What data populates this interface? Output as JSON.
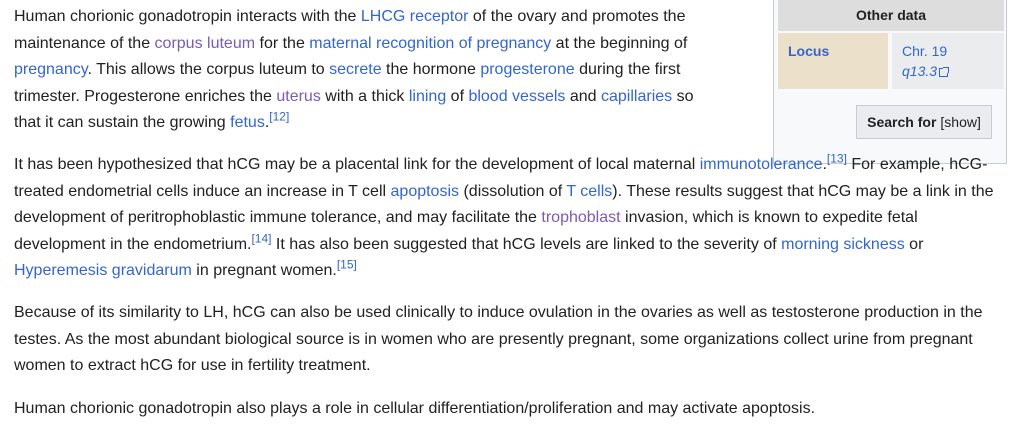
{
  "infobox": {
    "header": "Other data",
    "locus_label": "Locus",
    "chromosome": "Chr. 19",
    "band": "q13.3",
    "search_label": "Search for",
    "show_toggle": "[show]"
  },
  "paragraphs": {
    "p1": {
      "t1": "Human chorionic gonadotropin interacts with the ",
      "l1": "LHCG receptor",
      "t2": " of the ovary and promotes the maintenance of the ",
      "l2": "corpus luteum",
      "t3": " for the ",
      "l3": "maternal recognition of pregnancy",
      "t4": " at the beginning of ",
      "l4": "pregnancy",
      "t5": ". This allows the corpus luteum to ",
      "l5": "secrete",
      "t6": " the hormone ",
      "l6": "progesterone",
      "t7": " during the first trimester. Progesterone enriches the ",
      "l7": "uterus",
      "t8": " with a thick ",
      "l8": "lining",
      "t9": " of ",
      "l9": "blood vessels",
      "t10": " and ",
      "l10": "capillaries",
      "t11": " so that it can sustain the growing ",
      "l11": "fetus",
      "t12": ".",
      "ref": "[12]"
    },
    "p2": {
      "t1": "It has been hypothesized that hCG may be a placental link for the development of local maternal ",
      "l1": "immunotolerance",
      "t2": ".",
      "ref1": "[13]",
      "t3": " For example, hCG-treated endometrial cells induce an increase in T cell ",
      "l2": "apoptosis",
      "t4": " (dissolution of ",
      "l3": "T cells",
      "t5": "). These results suggest that hCG may be a link in the development of peritrophoblastic immune tolerance, and may facilitate the ",
      "l4": "trophoblast",
      "t6": " invasion, which is known to expedite fetal development in the endometrium.",
      "ref2": "[14]",
      "t7": " It has also been suggested that hCG levels are linked to the severity of ",
      "l5": "morning sickness",
      "t8": " or ",
      "l6": "Hyperemesis gravidarum",
      "t9": " in pregnant women.",
      "ref3": "[15]"
    },
    "p3": {
      "text": "Because of its similarity to LH, hCG can also be used clinically to induce ovulation in the ovaries as well as testosterone production in the testes. As the most abundant biological source is in women who are presently pregnant, some organizations collect urine from pregnant women to extract hCG for use in fertility treatment."
    },
    "p4": {
      "text": "Human chorionic gonadotropin also plays a role in cellular differentiation/proliferation and may activate apoptosis."
    }
  }
}
